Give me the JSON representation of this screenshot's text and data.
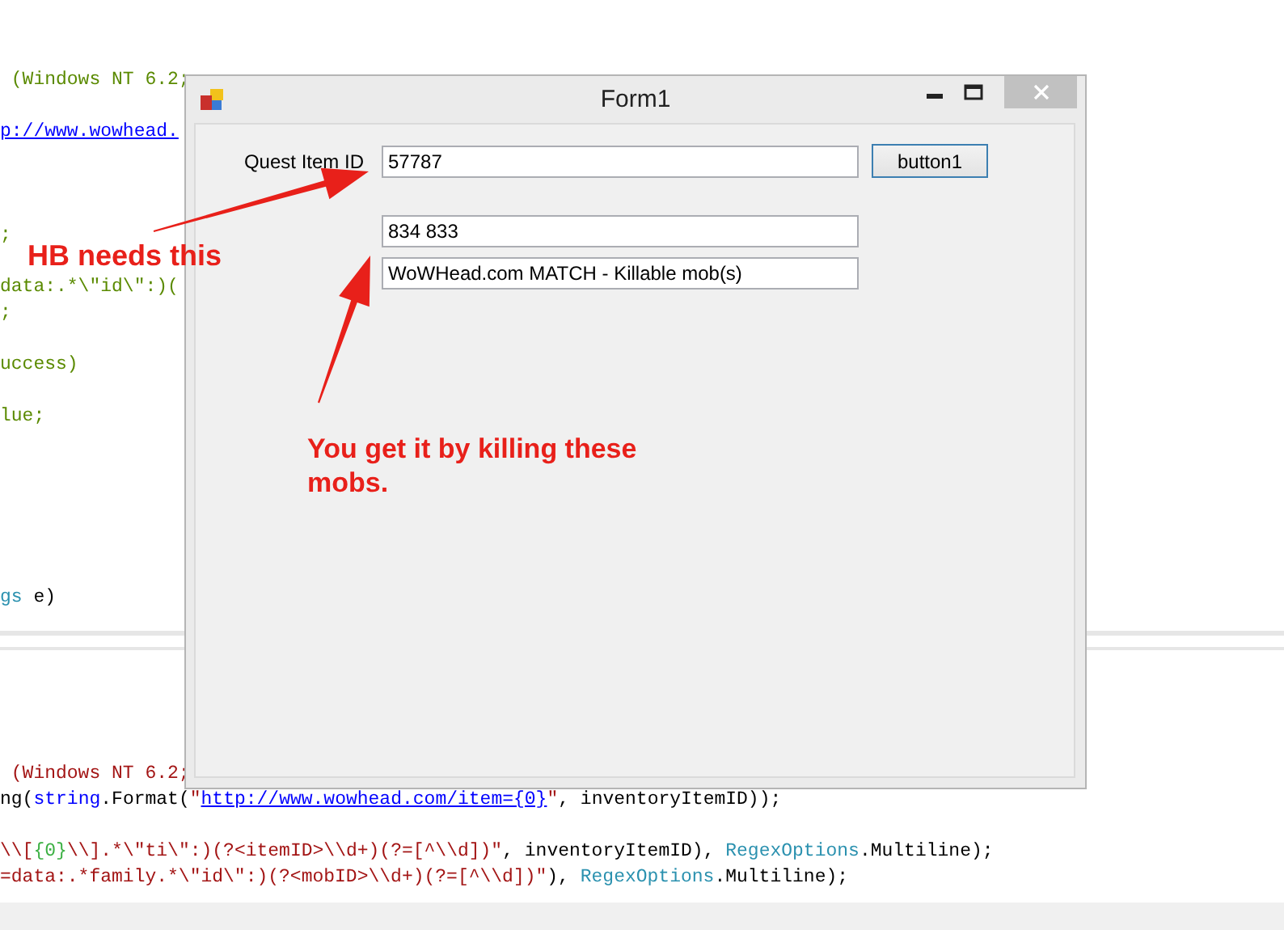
{
  "editor_top": {
    "lines": [
      {
        "kind": "code",
        "segments": [
          {
            "text": " (Windows NT 6.2;",
            "kind": "comment"
          }
        ]
      },
      {
        "kind": "blank"
      },
      {
        "kind": "code",
        "segments": [
          {
            "text": "p://www.wowhead.",
            "kind": "link"
          }
        ]
      },
      {
        "kind": "blank"
      },
      {
        "kind": "blank"
      },
      {
        "kind": "blank"
      },
      {
        "kind": "code",
        "segments": [
          {
            "text": ";",
            "kind": "comment"
          }
        ]
      },
      {
        "kind": "blank"
      },
      {
        "kind": "code",
        "segments": [
          {
            "text": "data:.*\\\"id\\\":)(",
            "kind": "comment"
          }
        ]
      },
      {
        "kind": "code",
        "segments": [
          {
            "text": ";",
            "kind": "comment"
          }
        ]
      },
      {
        "kind": "blank"
      },
      {
        "kind": "code",
        "segments": [
          {
            "text": "uccess)",
            "kind": "comment"
          }
        ]
      },
      {
        "kind": "blank"
      },
      {
        "kind": "code",
        "segments": [
          {
            "text": "lue;",
            "kind": "comment"
          }
        ]
      },
      {
        "kind": "blank"
      },
      {
        "kind": "blank"
      },
      {
        "kind": "blank"
      },
      {
        "kind": "blank"
      },
      {
        "kind": "blank"
      },
      {
        "kind": "blank"
      },
      {
        "kind": "code",
        "segments": [
          {
            "text": "gs",
            "kind": "type"
          },
          {
            "text": " e)",
            "kind": "plain"
          }
        ]
      }
    ]
  },
  "editor_bottom": {
    "lines": [
      {
        "kind": "blank"
      },
      {
        "kind": "blank"
      },
      {
        "kind": "blank"
      },
      {
        "kind": "blank"
      },
      {
        "kind": "code",
        "segments": [
          {
            "text": " (Windows NT 6.2;",
            "kind": "string"
          }
        ]
      },
      {
        "kind": "code",
        "segments": [
          {
            "text": "ng(",
            "kind": "plain"
          },
          {
            "text": "string",
            "kind": "keyword"
          },
          {
            "text": ".Format(",
            "kind": "plain"
          },
          {
            "text": "\"",
            "kind": "string"
          },
          {
            "text": "http://www.wowhead.com/item={0}",
            "kind": "link"
          },
          {
            "text": "\"",
            "kind": "string"
          },
          {
            "text": ", inventoryItemID));",
            "kind": "plain"
          }
        ]
      },
      {
        "kind": "blank"
      },
      {
        "kind": "code",
        "segments": [
          {
            "text": "\\\\[",
            "kind": "string"
          },
          {
            "text": "{0}",
            "kind": "format"
          },
          {
            "text": "\\\\].*\\\"ti\\\":)(?<itemID>\\\\d+)(?=[^\\\\d])\"",
            "kind": "string"
          },
          {
            "text": ", inventoryItemID), ",
            "kind": "plain"
          },
          {
            "text": "RegexOptions",
            "kind": "type"
          },
          {
            "text": ".Multiline);",
            "kind": "plain"
          }
        ]
      },
      {
        "kind": "code",
        "segments": [
          {
            "text": "=data:.*family.*\\\"id\\\":)(?<mobID>\\\\d+)(?=[^\\\\d])\"",
            "kind": "string"
          },
          {
            "text": "), ",
            "kind": "plain"
          },
          {
            "text": "RegexOptions",
            "kind": "type"
          },
          {
            "text": ".Multiline);",
            "kind": "plain"
          }
        ]
      }
    ]
  },
  "window": {
    "title": "Form1",
    "label": "Quest Item ID",
    "item_id_field": "57787",
    "button": "button1",
    "mob_ids_field": "834 833",
    "status_field": "WoWHead.com MATCH - Killable mob(s)"
  },
  "annotations": [
    "HB needs this",
    "You get it by killing these mobs."
  ]
}
